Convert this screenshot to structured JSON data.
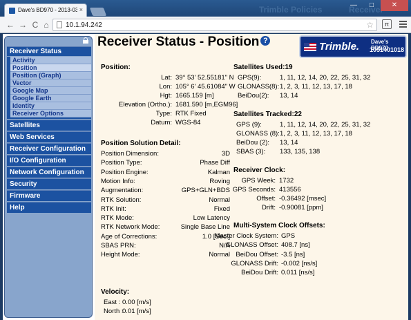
{
  "browser": {
    "tab_title": "Dave's BD970 - 2013-03-2",
    "tab_close": "×",
    "bg_texts": [
      "Trimble Policies",
      "Receiver"
    ],
    "url": "10.1.94.242",
    "win_min": "—",
    "win_max": "□",
    "win_close": "✕"
  },
  "nav": {
    "back": "←",
    "forward": "→",
    "reload": "C",
    "home": "⌂",
    "star": "☆"
  },
  "sidebar": {
    "sections": [
      {
        "label": "Receiver Status",
        "active": true,
        "items": [
          {
            "label": "Activity"
          },
          {
            "label": "Position",
            "active": true
          },
          {
            "label": "Position (Graph)"
          },
          {
            "label": "Vector"
          },
          {
            "label": "Google Map"
          },
          {
            "label": "Google Earth"
          },
          {
            "label": "Identity"
          },
          {
            "label": "Receiver Options"
          }
        ]
      },
      {
        "label": "Satellites"
      },
      {
        "label": "Web Services"
      },
      {
        "label": "Receiver Configuration"
      },
      {
        "label": "I/O Configuration"
      },
      {
        "label": "Network Configuration"
      },
      {
        "label": "Security"
      },
      {
        "label": "Firmware"
      },
      {
        "label": "Help"
      }
    ]
  },
  "header": {
    "title": "Receiver Status - Position",
    "help": "?",
    "logo_name": "Trimble.",
    "logo_model": "Dave's BD970",
    "logo_serial": "1051401018"
  },
  "position": {
    "heading": "Position:",
    "rows": [
      {
        "label": "Lat:",
        "value": "39° 53' 52.55181\"  N"
      },
      {
        "label": "Lon:",
        "value": "105°  6' 45.61084\" W"
      },
      {
        "label": "Hgt:",
        "value": "1665.159 [m]"
      },
      {
        "label": "Elevation (Ortho.):",
        "value": "1681.590 [m,EGM96]"
      },
      {
        "label": "Type:",
        "value": "RTK Fixed"
      },
      {
        "label": "Datum:",
        "value": "WGS-84"
      }
    ]
  },
  "solution": {
    "heading": "Position Solution Detail:",
    "rows": [
      {
        "label": "Position Dimension:",
        "value": "3D"
      },
      {
        "label": "Position Type:",
        "value": "Phase Diff"
      },
      {
        "label": "Position Engine:",
        "value": "Kalman"
      },
      {
        "label": "Motion Info:",
        "value": "Roving"
      },
      {
        "label": "Augmentation:",
        "value": "GPS+GLN+BDS"
      },
      {
        "label": "RTK Solution:",
        "value": "Normal"
      },
      {
        "label": "RTK Init:",
        "value": "Fixed"
      },
      {
        "label": "RTK Mode:",
        "value": "Low Latency"
      },
      {
        "label": "RTK Network Mode:",
        "value": "Single Base Line"
      },
      {
        "label": "Age of Corrections:",
        "value": "1.0 [Sec.]"
      },
      {
        "label": "SBAS PRN:",
        "value": "N/A"
      },
      {
        "label": "Height Mode:",
        "value": "Normal"
      }
    ]
  },
  "velocity": {
    "heading": "Velocity:",
    "rows": [
      {
        "label": "East :",
        "value": "0.00 [m/s]"
      },
      {
        "label": "North :",
        "value": "0.01 [m/s]"
      }
    ]
  },
  "sats_used": {
    "heading": "Satellites Used:19",
    "rows": [
      {
        "label": "GPS(9):",
        "value": "1, 11, 12, 14, 20, 22, 25, 31, 32"
      },
      {
        "label": "GLONASS(8):",
        "value": "1, 2, 3, 11, 12, 13, 17, 18"
      },
      {
        "label": "BeiDou(2):",
        "value": "13, 14"
      }
    ]
  },
  "sats_tracked": {
    "heading": "Satellites Tracked:22",
    "rows": [
      {
        "label": "GPS (9):",
        "value": "1, 11, 12, 14, 20, 22, 25, 31, 32"
      },
      {
        "label": "GLONASS (8):",
        "value": "1, 2, 3, 11, 12, 13, 17, 18"
      },
      {
        "label": "BeiDou (2):",
        "value": "13, 14"
      },
      {
        "label": "SBAS (3):",
        "value": "133, 135, 138"
      }
    ]
  },
  "clock": {
    "heading": "Receiver Clock:",
    "rows": [
      {
        "label": "GPS Week:",
        "value": "1732"
      },
      {
        "label": "GPS Seconds:",
        "value": "413556"
      },
      {
        "label": "Offset:",
        "value": "-0.36492 [msec]"
      },
      {
        "label": "Drift:",
        "value": "-0.90081  [ppm]"
      }
    ]
  },
  "multi": {
    "heading": "Multi-System Clock Offsets:",
    "rows": [
      {
        "label": "Master Clock System:",
        "value": "GPS"
      },
      {
        "label": "GLONASS Offset:",
        "value": "408.7 [ns]"
      },
      {
        "label": "BeiDou Offset:",
        "value": "-3.5 [ns]"
      },
      {
        "label": "GLONASS Drift:",
        "value": "-0.002 [ns/s]"
      },
      {
        "label": "BeiDou Drift:",
        "value": "0.011 [ns/s]"
      }
    ]
  }
}
